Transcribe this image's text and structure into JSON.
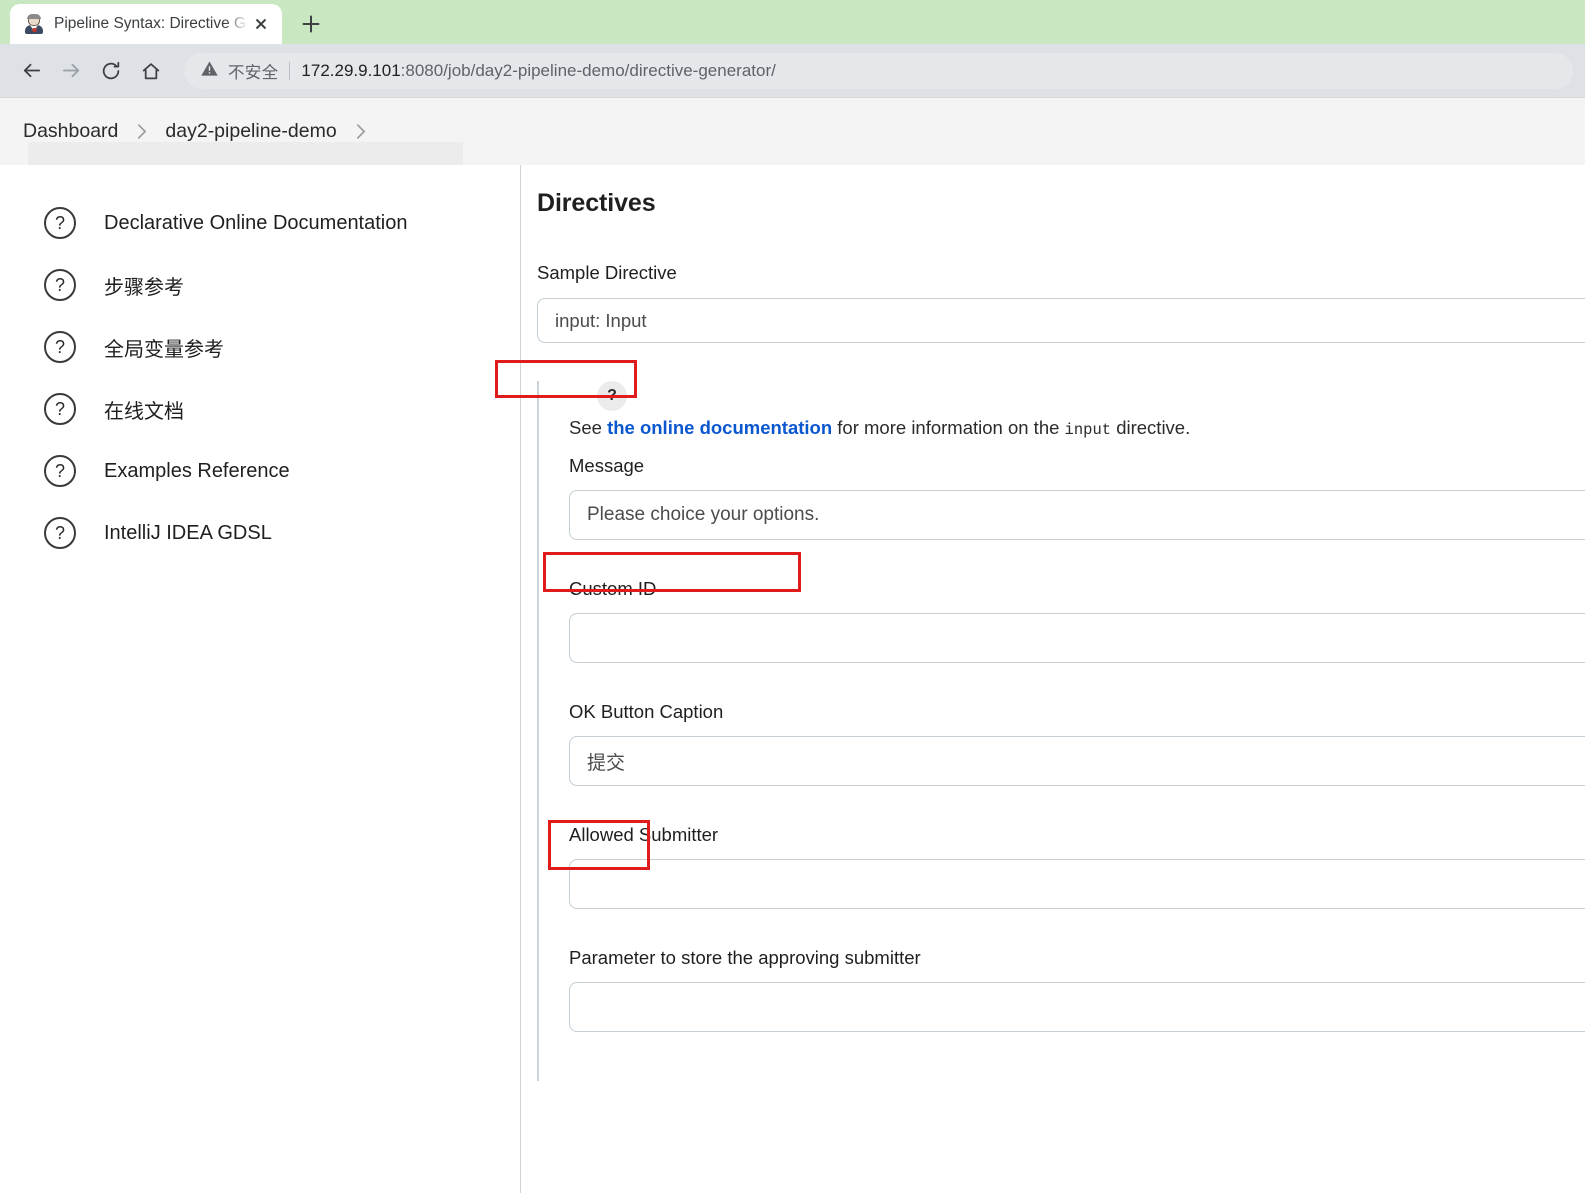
{
  "browser": {
    "tab": {
      "title": "Pipeline Syntax: Directive Gene",
      "favicon_name": "jenkins-butler-favicon",
      "close_label": "×"
    },
    "new_tab_label": "+",
    "nav": {
      "back_label": "←",
      "forward_label": "→",
      "reload_label": "⟳",
      "home_label": "⌂"
    },
    "omnibox": {
      "security_label": "不安全",
      "url_host": "172.29.9.101",
      "url_rest": ":8080/job/day2-pipeline-demo/directive-generator/",
      "full_url": "172.29.9.101:8080/job/day2-pipeline-demo/directive-generator/"
    }
  },
  "breadcrumb": {
    "items": [
      {
        "label": "Dashboard"
      },
      {
        "label": "day2-pipeline-demo"
      }
    ],
    "separator": "›"
  },
  "sidebar": {
    "items": [
      {
        "label": "Declarative Online Documentation",
        "icon": "question-circle-icon"
      },
      {
        "label": "步骤参考",
        "icon": "question-circle-icon"
      },
      {
        "label": "全局变量参考",
        "icon": "question-circle-icon"
      },
      {
        "label": "在线文档",
        "icon": "question-circle-icon"
      },
      {
        "label": "Examples Reference",
        "icon": "question-circle-icon"
      },
      {
        "label": "IntelliJ IDEA GDSL",
        "icon": "question-circle-icon"
      }
    ]
  },
  "main": {
    "title": "Directives",
    "sample_directive": {
      "label": "Sample Directive",
      "selected": "input: Input"
    },
    "help": {
      "badge": "?",
      "prefix": "See ",
      "link": "the online documentation",
      "middle": " for more information on the ",
      "code": "input",
      "suffix": " directive."
    },
    "fields": [
      {
        "label": "Message",
        "value": "Please choice your options.",
        "placeholder": ""
      },
      {
        "label": "Custom ID",
        "value": "",
        "placeholder": ""
      },
      {
        "label": "OK Button Caption",
        "value": "提交",
        "placeholder": ""
      },
      {
        "label": "Allowed Submitter",
        "value": "",
        "placeholder": ""
      },
      {
        "label": "Parameter to store the approving submitter",
        "value": "",
        "placeholder": ""
      }
    ]
  },
  "annotations": {
    "highlight_color": "#e01b1b",
    "boxes": [
      {
        "name": "sample-directive-highlight"
      },
      {
        "name": "message-value-highlight"
      },
      {
        "name": "ok-button-caption-highlight"
      }
    ]
  },
  "colors": {
    "tabstrip": "#c9e8c2",
    "toolbar": "#dee1e6",
    "link": "#0b57d0",
    "border": "#c4ced4"
  }
}
